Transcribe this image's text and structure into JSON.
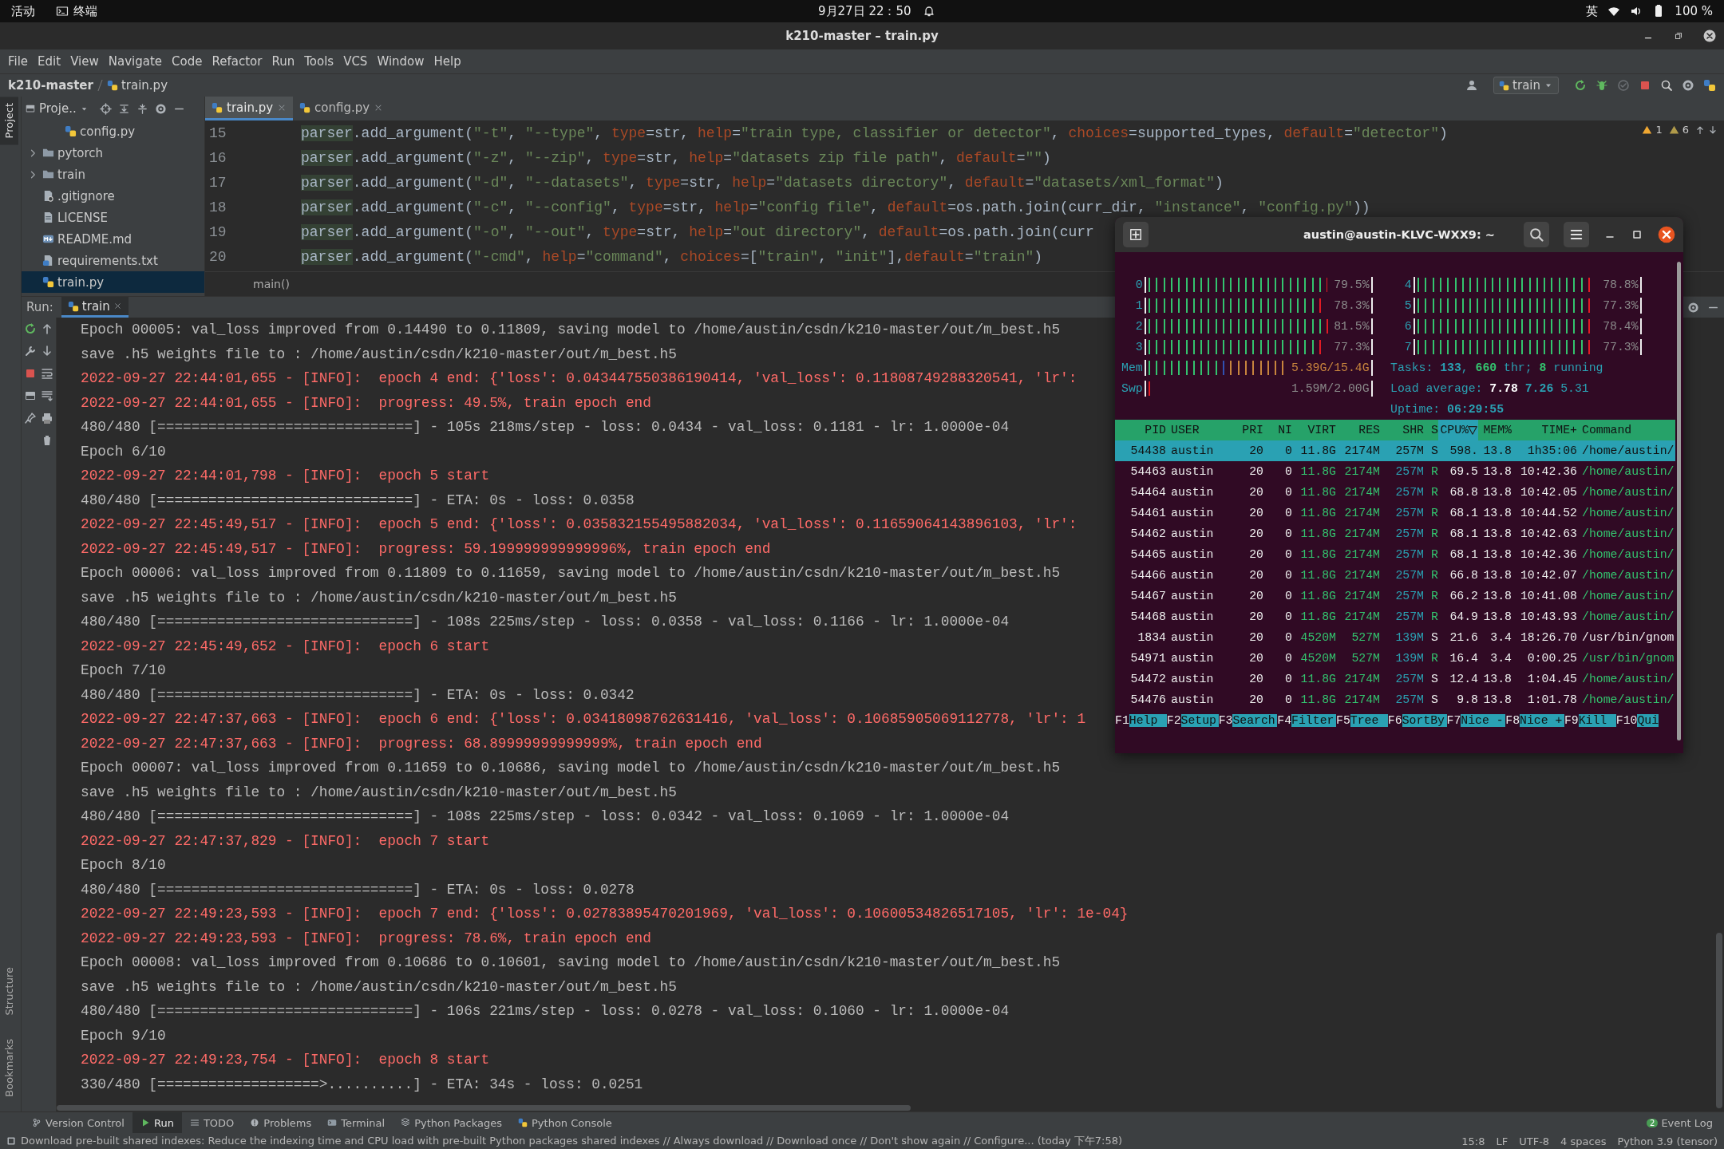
{
  "os_bar": {
    "activities": "活动",
    "app": "终端",
    "clock": "9月27日  22：50",
    "input_method": "英",
    "battery": "100 %"
  },
  "window": {
    "title": "k210-master – train.py"
  },
  "menu": [
    "File",
    "Edit",
    "View",
    "Navigate",
    "Code",
    "Refactor",
    "Run",
    "Tools",
    "VCS",
    "Window",
    "Help"
  ],
  "breadcrumb": {
    "project": "k210-master",
    "file": "train.py"
  },
  "run_config": "train",
  "tool_strip": {
    "project": "Project",
    "structure": "Structure",
    "bookmarks": "Bookmarks"
  },
  "project_panel": {
    "title": "Proje..",
    "tree": [
      {
        "children": [
          {
            "label": "config.py",
            "kind": "python",
            "selected": false
          }
        ]
      },
      {
        "label": "pytorch",
        "kind": "folder",
        "expanded": false,
        "selected": false
      },
      {
        "label": "train",
        "kind": "folder",
        "expanded": false,
        "selected": false
      },
      {
        "label": ".gitignore",
        "kind": "ignore",
        "selected": false
      },
      {
        "label": "LICENSE",
        "kind": "text",
        "selected": false
      },
      {
        "label": "README.md",
        "kind": "markdown",
        "selected": false
      },
      {
        "label": "requirements.txt",
        "kind": "requirements",
        "selected": false
      },
      {
        "label": "train.py",
        "kind": "python",
        "selected": true
      }
    ]
  },
  "editor": {
    "tabs": [
      {
        "label": "train.py",
        "selected": true
      },
      {
        "label": "config.py",
        "selected": false
      }
    ],
    "inspections": {
      "warnings": "1",
      "weak_warnings": "6"
    },
    "lines": [
      {
        "number": "15",
        "tokens": [
          {
            "kind": "h",
            "text": "parser"
          },
          {
            "kind": "t",
            "text": ".add_argument("
          },
          {
            "kind": "s",
            "text": "\"-t\""
          },
          {
            "kind": "t",
            "text": ", "
          },
          {
            "kind": "s",
            "text": "\"--type\""
          },
          {
            "kind": "t",
            "text": ", "
          },
          {
            "kind": "k",
            "text": "type"
          },
          {
            "kind": "t",
            "text": "=str, "
          },
          {
            "kind": "k",
            "text": "help"
          },
          {
            "kind": "t",
            "text": "="
          },
          {
            "kind": "s",
            "text": "\"train type, classifier or detector\""
          },
          {
            "kind": "t",
            "text": ", "
          },
          {
            "kind": "k",
            "text": "choices"
          },
          {
            "kind": "t",
            "text": "=supported_types, "
          },
          {
            "kind": "k",
            "text": "default"
          },
          {
            "kind": "t",
            "text": "="
          },
          {
            "kind": "s",
            "text": "\"detector\""
          },
          {
            "kind": "t",
            "text": ")"
          }
        ]
      },
      {
        "number": "16",
        "tokens": [
          {
            "kind": "h",
            "text": "parser"
          },
          {
            "kind": "t",
            "text": ".add_argument("
          },
          {
            "kind": "s",
            "text": "\"-z\""
          },
          {
            "kind": "t",
            "text": ", "
          },
          {
            "kind": "s",
            "text": "\"--zip\""
          },
          {
            "kind": "t",
            "text": ", "
          },
          {
            "kind": "k",
            "text": "type"
          },
          {
            "kind": "t",
            "text": "=str, "
          },
          {
            "kind": "k",
            "text": "help"
          },
          {
            "kind": "t",
            "text": "="
          },
          {
            "kind": "s",
            "text": "\"datasets zip file path\""
          },
          {
            "kind": "t",
            "text": ", "
          },
          {
            "kind": "k",
            "text": "default"
          },
          {
            "kind": "t",
            "text": "="
          },
          {
            "kind": "s",
            "text": "\"\""
          },
          {
            "kind": "t",
            "text": ")"
          }
        ]
      },
      {
        "number": "17",
        "tokens": [
          {
            "kind": "h",
            "text": "parser"
          },
          {
            "kind": "t",
            "text": ".add_argument("
          },
          {
            "kind": "s",
            "text": "\"-d\""
          },
          {
            "kind": "t",
            "text": ", "
          },
          {
            "kind": "s",
            "text": "\"--datasets\""
          },
          {
            "kind": "t",
            "text": ", "
          },
          {
            "kind": "k",
            "text": "type"
          },
          {
            "kind": "t",
            "text": "=str, "
          },
          {
            "kind": "k",
            "text": "help"
          },
          {
            "kind": "t",
            "text": "="
          },
          {
            "kind": "s",
            "text": "\"datasets directory\""
          },
          {
            "kind": "t",
            "text": ", "
          },
          {
            "kind": "k",
            "text": "default"
          },
          {
            "kind": "t",
            "text": "="
          },
          {
            "kind": "s",
            "text": "\"datasets/xml_format\""
          },
          {
            "kind": "t",
            "text": ")"
          }
        ]
      },
      {
        "number": "18",
        "tokens": [
          {
            "kind": "h",
            "text": "parser"
          },
          {
            "kind": "t",
            "text": ".add_argument("
          },
          {
            "kind": "s",
            "text": "\"-c\""
          },
          {
            "kind": "t",
            "text": ", "
          },
          {
            "kind": "s",
            "text": "\"--config\""
          },
          {
            "kind": "t",
            "text": ", "
          },
          {
            "kind": "k",
            "text": "type"
          },
          {
            "kind": "t",
            "text": "=str, "
          },
          {
            "kind": "k",
            "text": "help"
          },
          {
            "kind": "t",
            "text": "="
          },
          {
            "kind": "s",
            "text": "\"config file\""
          },
          {
            "kind": "t",
            "text": ", "
          },
          {
            "kind": "k",
            "text": "default"
          },
          {
            "kind": "t",
            "text": "=os.path.join(curr_dir, "
          },
          {
            "kind": "s",
            "text": "\"instance\""
          },
          {
            "kind": "t",
            "text": ", "
          },
          {
            "kind": "s",
            "text": "\"config.py\""
          },
          {
            "kind": "t",
            "text": "))"
          }
        ]
      },
      {
        "number": "19",
        "tokens": [
          {
            "kind": "h",
            "text": "parser"
          },
          {
            "kind": "t",
            "text": ".add_argument("
          },
          {
            "kind": "s",
            "text": "\"-o\""
          },
          {
            "kind": "t",
            "text": ", "
          },
          {
            "kind": "s",
            "text": "\"--out\""
          },
          {
            "kind": "t",
            "text": ", "
          },
          {
            "kind": "k",
            "text": "type"
          },
          {
            "kind": "t",
            "text": "=str, "
          },
          {
            "kind": "k",
            "text": "help"
          },
          {
            "kind": "t",
            "text": "="
          },
          {
            "kind": "s",
            "text": "\"out directory\""
          },
          {
            "kind": "t",
            "text": ", "
          },
          {
            "kind": "k",
            "text": "default"
          },
          {
            "kind": "t",
            "text": "=os.path.join(curr"
          }
        ]
      },
      {
        "number": "20",
        "tokens": [
          {
            "kind": "h",
            "text": "parser"
          },
          {
            "kind": "t",
            "text": ".add_argument("
          },
          {
            "kind": "s",
            "text": "\"-cmd\""
          },
          {
            "kind": "t",
            "text": ", "
          },
          {
            "kind": "k",
            "text": "help"
          },
          {
            "kind": "t",
            "text": "="
          },
          {
            "kind": "s",
            "text": "\"command\""
          },
          {
            "kind": "t",
            "text": ", "
          },
          {
            "kind": "k",
            "text": "choices"
          },
          {
            "kind": "t",
            "text": "=["
          },
          {
            "kind": "s",
            "text": "\"train\""
          },
          {
            "kind": "t",
            "text": ", "
          },
          {
            "kind": "s",
            "text": "\"init\""
          },
          {
            "kind": "t",
            "text": "],"
          },
          {
            "kind": "k",
            "text": "default"
          },
          {
            "kind": "t",
            "text": "="
          },
          {
            "kind": "s",
            "text": "\"train\""
          },
          {
            "kind": "t",
            "text": ")"
          }
        ]
      }
    ],
    "context": "main()"
  },
  "run_panel": {
    "label": "Run:",
    "tab": "train",
    "lines": [
      {
        "kind": "plain",
        "text": "Epoch 00005: val_loss improved from 0.14490 to 0.11809, saving model to /home/austin/csdn/k210-master/out/m_best.h5"
      },
      {
        "kind": "plain",
        "text": "save .h5 weights file to : /home/austin/csdn/k210-master/out/m_best.h5"
      },
      {
        "kind": "info",
        "text": "2022-09-27 22:44:01,655 - [INFO]:  epoch 4 end: {'loss': 0.043447550386190414, 'val_loss': 0.11808749288320541, 'lr':"
      },
      {
        "kind": "info",
        "text": "2022-09-27 22:44:01,655 - [INFO]:  progress: 49.5%, train epoch end"
      },
      {
        "kind": "plain",
        "text": "480/480 [==============================] - 105s 218ms/step - loss: 0.0434 - val_loss: 0.1181 - lr: 1.0000e-04"
      },
      {
        "kind": "plain",
        "text": "Epoch 6/10"
      },
      {
        "kind": "info",
        "text": "2022-09-27 22:44:01,798 - [INFO]:  epoch 5 start"
      },
      {
        "kind": "plain",
        "text": "480/480 [==============================] - ETA: 0s - loss: 0.0358"
      },
      {
        "kind": "info",
        "text": "2022-09-27 22:45:49,517 - [INFO]:  epoch 5 end: {'loss': 0.035832155495882034, 'val_loss': 0.11659064143896103, 'lr':"
      },
      {
        "kind": "info",
        "text": "2022-09-27 22:45:49,517 - [INFO]:  progress: 59.199999999999996%, train epoch end"
      },
      {
        "kind": "plain",
        "text": "Epoch 00006: val_loss improved from 0.11809 to 0.11659, saving model to /home/austin/csdn/k210-master/out/m_best.h5"
      },
      {
        "kind": "plain",
        "text": "save .h5 weights file to : /home/austin/csdn/k210-master/out/m_best.h5"
      },
      {
        "kind": "plain",
        "text": "480/480 [==============================] - 108s 225ms/step - loss: 0.0358 - val_loss: 0.1166 - lr: 1.0000e-04"
      },
      {
        "kind": "info",
        "text": "2022-09-27 22:45:49,652 - [INFO]:  epoch 6 start"
      },
      {
        "kind": "plain",
        "text": "Epoch 7/10"
      },
      {
        "kind": "plain",
        "text": "480/480 [==============================] - ETA: 0s - loss: 0.0342"
      },
      {
        "kind": "info",
        "text": "2022-09-27 22:47:37,663 - [INFO]:  epoch 6 end: {'loss': 0.03418098762631416, 'val_loss': 0.10685905069112778, 'lr': 1"
      },
      {
        "kind": "info",
        "text": "2022-09-27 22:47:37,663 - [INFO]:  progress: 68.89999999999999%, train epoch end"
      },
      {
        "kind": "plain",
        "text": "Epoch 00007: val_loss improved from 0.11659 to 0.10686, saving model to /home/austin/csdn/k210-master/out/m_best.h5"
      },
      {
        "kind": "plain",
        "text": "save .h5 weights file to : /home/austin/csdn/k210-master/out/m_best.h5"
      },
      {
        "kind": "plain",
        "text": "480/480 [==============================] - 108s 225ms/step - loss: 0.0342 - val_loss: 0.1069 - lr: 1.0000e-04"
      },
      {
        "kind": "info",
        "text": "2022-09-27 22:47:37,829 - [INFO]:  epoch 7 start"
      },
      {
        "kind": "plain",
        "text": "Epoch 8/10"
      },
      {
        "kind": "plain",
        "text": "480/480 [==============================] - ETA: 0s - loss: 0.0278"
      },
      {
        "kind": "info",
        "text": "2022-09-27 22:49:23,593 - [INFO]:  epoch 7 end: {'loss': 0.02783895470201969, 'val_loss': 0.10600534826517105, 'lr': 1e-04}"
      },
      {
        "kind": "info",
        "text": "2022-09-27 22:49:23,593 - [INFO]:  progress: 78.6%, train epoch end"
      },
      {
        "kind": "plain",
        "text": "Epoch 00008: val_loss improved from 0.10686 to 0.10601, saving model to /home/austin/csdn/k210-master/out/m_best.h5"
      },
      {
        "kind": "plain",
        "text": "save .h5 weights file to : /home/austin/csdn/k210-master/out/m_best.h5"
      },
      {
        "kind": "plain",
        "text": "480/480 [==============================] - 106s 221ms/step - loss: 0.0278 - val_loss: 0.1060 - lr: 1.0000e-04"
      },
      {
        "kind": "plain",
        "text": "Epoch 9/10"
      },
      {
        "kind": "info",
        "text": "2022-09-27 22:49:23,754 - [INFO]:  epoch 8 start"
      },
      {
        "kind": "plain",
        "text": "330/480 [===================>..........] - ETA: 34s - loss: 0.0251"
      }
    ]
  },
  "terminal": {
    "title": "austin@austin-KLVC-WXX9: ~",
    "cpus": [
      {
        "label": "0",
        "value": "79.5%",
        "level": 0.795
      },
      {
        "label": "1",
        "value": "78.3%",
        "level": 0.783
      },
      {
        "label": "2",
        "value": "81.5%",
        "level": 0.815
      },
      {
        "label": "3",
        "value": "77.3%",
        "level": 0.773
      },
      {
        "label": "4",
        "value": "78.8%",
        "level": 0.788
      },
      {
        "label": "5",
        "value": "77.3%",
        "level": 0.773
      },
      {
        "label": "6",
        "value": "78.4%",
        "level": 0.784
      },
      {
        "label": "7",
        "value": "77.3%",
        "level": 0.773
      }
    ],
    "mem": {
      "label": "Mem",
      "value": "5.39G/15.4G",
      "level": 0.6
    },
    "swap": {
      "label": "Swp",
      "value": "1.59M/2.00G",
      "level": 0.02
    },
    "info_lines": [
      [
        {
          "kind": "label",
          "text": "Tasks: "
        },
        {
          "kind": "cyan",
          "text": "133"
        },
        {
          "kind": "label",
          "text": ", "
        },
        {
          "kind": "green",
          "text": "660"
        },
        {
          "kind": "label",
          "text": " thr; "
        },
        {
          "kind": "green",
          "text": "8"
        },
        {
          "kind": "label",
          "text": " running"
        }
      ],
      [
        {
          "kind": "label",
          "text": "Load average: "
        },
        {
          "kind": "white",
          "text": "7.78"
        },
        {
          "kind": "cyan",
          "text": " 7.26"
        },
        {
          "kind": "label",
          "text": " 5.31"
        }
      ],
      [
        {
          "kind": "label",
          "text": "Uptime: "
        },
        {
          "kind": "cyan",
          "text": "06:29:55"
        }
      ]
    ],
    "columns": [
      {
        "label": "PID",
        "sorted": false
      },
      {
        "label": "USER",
        "sorted": false
      },
      {
        "label": "PRI",
        "sorted": false
      },
      {
        "label": "NI",
        "sorted": false
      },
      {
        "label": "VIRT",
        "sorted": false
      },
      {
        "label": "RES",
        "sorted": false
      },
      {
        "label": "SHR",
        "sorted": false
      },
      {
        "label": "S",
        "sorted": false
      },
      {
        "label": "CPU%",
        "sorted": true
      },
      {
        "label": "MEM%",
        "sorted": false
      },
      {
        "label": "TIME+",
        "sorted": false
      },
      {
        "label": "Command",
        "sorted": false
      }
    ],
    "processes": [
      {
        "cells": [
          "54438",
          "austin",
          "20",
          "0",
          "11.8G",
          "2174M",
          "257M",
          "S",
          "598.",
          "13.8",
          "1h35:06",
          "/home/austin/"
        ],
        "selected": true
      },
      {
        "cells": [
          "54463",
          "austin",
          "20",
          "0",
          "11.8G",
          "2174M",
          "257M",
          "R",
          "69.5",
          "13.8",
          "10:42.36",
          "/home/austin/"
        ],
        "selected": false,
        "running": true,
        "thread": true
      },
      {
        "cells": [
          "54464",
          "austin",
          "20",
          "0",
          "11.8G",
          "2174M",
          "257M",
          "R",
          "68.8",
          "13.8",
          "10:42.05",
          "/home/austin/"
        ],
        "selected": false,
        "running": true,
        "thread": true
      },
      {
        "cells": [
          "54461",
          "austin",
          "20",
          "0",
          "11.8G",
          "2174M",
          "257M",
          "R",
          "68.1",
          "13.8",
          "10:44.52",
          "/home/austin/"
        ],
        "selected": false,
        "running": true,
        "thread": true
      },
      {
        "cells": [
          "54462",
          "austin",
          "20",
          "0",
          "11.8G",
          "2174M",
          "257M",
          "R",
          "68.1",
          "13.8",
          "10:42.63",
          "/home/austin/"
        ],
        "selected": false,
        "running": true,
        "thread": true
      },
      {
        "cells": [
          "54465",
          "austin",
          "20",
          "0",
          "11.8G",
          "2174M",
          "257M",
          "R",
          "68.1",
          "13.8",
          "10:42.36",
          "/home/austin/"
        ],
        "selected": false,
        "running": true,
        "thread": true
      },
      {
        "cells": [
          "54466",
          "austin",
          "20",
          "0",
          "11.8G",
          "2174M",
          "257M",
          "R",
          "66.8",
          "13.8",
          "10:42.07",
          "/home/austin/"
        ],
        "selected": false,
        "running": true,
        "thread": true
      },
      {
        "cells": [
          "54467",
          "austin",
          "20",
          "0",
          "11.8G",
          "2174M",
          "257M",
          "R",
          "66.2",
          "13.8",
          "10:41.08",
          "/home/austin/"
        ],
        "selected": false,
        "running": true,
        "thread": true
      },
      {
        "cells": [
          "54468",
          "austin",
          "20",
          "0",
          "11.8G",
          "2174M",
          "257M",
          "R",
          "64.9",
          "13.8",
          "10:43.93",
          "/home/austin/"
        ],
        "selected": false,
        "running": true,
        "thread": true
      },
      {
        "cells": [
          "1834",
          "austin",
          "20",
          "0",
          "4520M",
          "527M",
          "139M",
          "S",
          "21.6",
          "3.4",
          "18:26.70",
          "/usr/bin/gnom"
        ],
        "selected": false,
        "running": false,
        "thread": false
      },
      {
        "cells": [
          "54971",
          "austin",
          "20",
          "0",
          "4520M",
          "527M",
          "139M",
          "R",
          "16.4",
          "3.4",
          "0:00.25",
          "/usr/bin/gnom"
        ],
        "selected": false,
        "running": true,
        "thread": true
      },
      {
        "cells": [
          "54472",
          "austin",
          "20",
          "0",
          "11.8G",
          "2174M",
          "257M",
          "S",
          "12.4",
          "13.8",
          "1:04.45",
          "/home/austin/"
        ],
        "selected": false,
        "running": false,
        "thread": true
      },
      {
        "cells": [
          "54476",
          "austin",
          "20",
          "0",
          "11.8G",
          "2174M",
          "257M",
          "S",
          "9.8",
          "13.8",
          "1:01.78",
          "/home/austin/"
        ],
        "selected": false,
        "running": false,
        "thread": true
      }
    ],
    "function_keys": [
      {
        "key": "F1",
        "label": "Help"
      },
      {
        "key": "F2",
        "label": "Setup"
      },
      {
        "key": "F3",
        "label": "Search"
      },
      {
        "key": "F4",
        "label": "Filter"
      },
      {
        "key": "F5",
        "label": "Tree"
      },
      {
        "key": "F6",
        "label": "SortBy"
      },
      {
        "key": "F7",
        "label": "Nice -"
      },
      {
        "key": "F8",
        "label": "Nice +"
      },
      {
        "key": "F9",
        "label": "Kill"
      },
      {
        "key": "F10",
        "label": "Qui"
      }
    ]
  },
  "tool_windows": [
    {
      "label": "Version Control",
      "selected": false
    },
    {
      "label": "Run",
      "selected": true
    },
    {
      "label": "TODO",
      "selected": false
    },
    {
      "label": "Problems",
      "selected": false
    },
    {
      "label": "Terminal",
      "selected": false
    },
    {
      "label": "Python Packages",
      "selected": false
    },
    {
      "label": "Python Console",
      "selected": false
    }
  ],
  "event_log": {
    "label": "Event Log",
    "count": "2"
  },
  "status_bar": {
    "message": "Download pre-built shared indexes: Reduce the indexing time and CPU load with pre-built Python packages shared indexes // Always download // Download once // Don't show again // Configure... (today 下午7:58)",
    "position": "15:8",
    "line_separator": "LF",
    "encoding": "UTF-8",
    "indent": "4 spaces",
    "interpreter": "Python 3.9 (tensor)"
  }
}
